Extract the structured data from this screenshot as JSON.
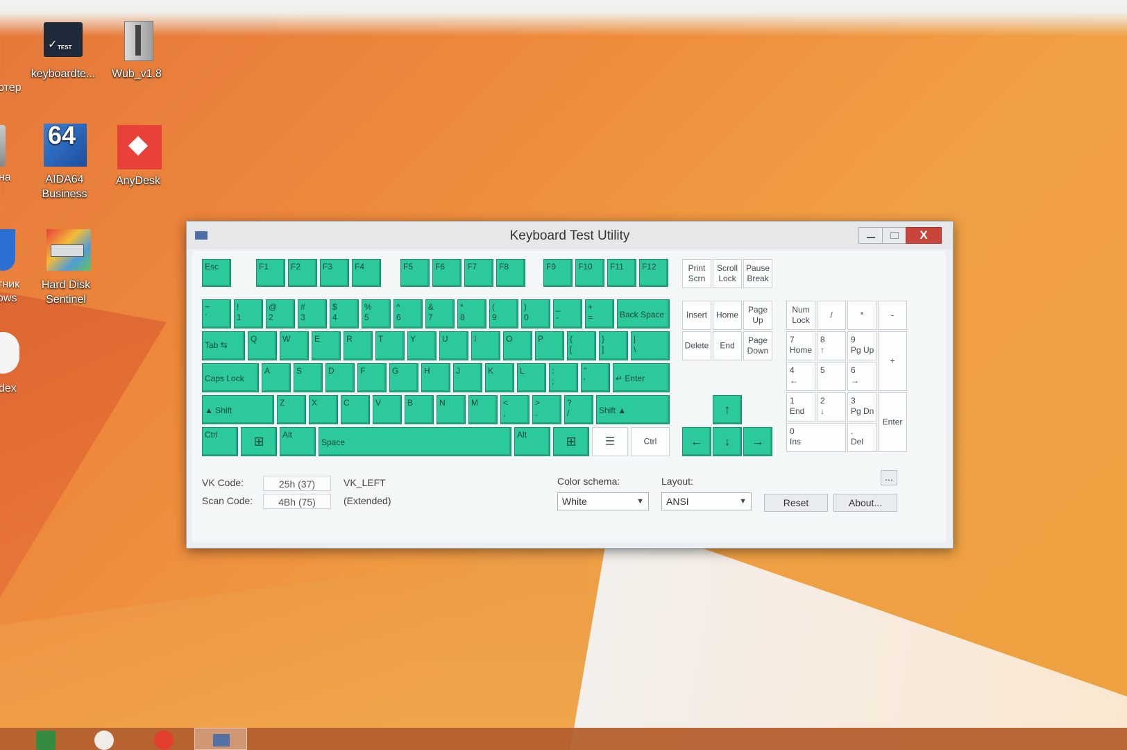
{
  "desktop": {
    "icons": [
      {
        "label": "keyboardte...",
        "name": "keyboardtest-shortcut"
      },
      {
        "label": "Wub_v1.8",
        "name": "wub-shortcut"
      },
      {
        "label": "AIDA64\nBusiness",
        "name": "aida64-shortcut"
      },
      {
        "label": "AnyDesk",
        "name": "anydesk-shortcut"
      },
      {
        "label": "Hard Disk\nSentinel",
        "name": "hard-disk-sentinel-shortcut"
      }
    ],
    "partial_labels": [
      "ютер",
      "на",
      "тник\nows",
      "dex"
    ]
  },
  "window": {
    "title": "Keyboard Test Utility",
    "close_glyph": "X"
  },
  "keyboard": {
    "fn_row": [
      "Esc",
      "F1",
      "F2",
      "F3",
      "F4",
      "F5",
      "F6",
      "F7",
      "F8",
      "F9",
      "F10",
      "F11",
      "F12"
    ],
    "row1": [
      "~\n`",
      "!\n1",
      "@\n2",
      "#\n3",
      "$\n4",
      "%\n5",
      "^\n6",
      "&\n7",
      "*\n8",
      "(\n9",
      ")\n0",
      "_\n-",
      "+\n=",
      "Back Space"
    ],
    "row2": [
      "Tab  ⇆",
      "Q",
      "W",
      "E",
      "R",
      "T",
      "Y",
      "U",
      "I",
      "O",
      "P",
      "{\n[",
      "}\n]",
      "|\n\\"
    ],
    "row3": [
      "Caps Lock",
      "A",
      "S",
      "D",
      "F",
      "G",
      "H",
      "J",
      "K",
      "L",
      ":\n;",
      "\"\n'",
      "↵  Enter"
    ],
    "row4": [
      "▲        Shift",
      "Z",
      "X",
      "C",
      "V",
      "B",
      "N",
      "M",
      "<\n,",
      ">\n.",
      "?\n/",
      "Shift          ▲"
    ],
    "row5": [
      "Ctrl",
      "⊞",
      "Alt",
      "Space",
      "Alt",
      "⊞",
      "☰",
      "Ctrl"
    ],
    "sys": [
      "Print\nScrn",
      "Scroll\nLock",
      "Pause\nBreak"
    ],
    "nav": [
      "Insert",
      "Home",
      "Page\nUp",
      "Delete",
      "End",
      "Page\nDown"
    ],
    "arrows": [
      "↑",
      "←",
      "↓",
      "→"
    ],
    "numpad": [
      "Num\nLock",
      "/",
      "*",
      "-",
      "7\nHome",
      "8\n↑",
      "9\nPg Up",
      "+",
      "4\n←",
      "5",
      "6\n→",
      "1\nEnd",
      "2\n↓",
      "3\nPg Dn",
      "Enter",
      "0\nIns",
      ".\nDel"
    ]
  },
  "status": {
    "vk_label": "VK Code:",
    "vk_value": "25h (37)",
    "vk_name": "VK_LEFT",
    "scan_label": "Scan Code:",
    "scan_value": "4Bh (75)",
    "scan_note": "(Extended)",
    "color_label": "Color schema:",
    "color_value": "White",
    "layout_label": "Layout:",
    "layout_value": "ANSI",
    "more_button": "...",
    "reset_button": "Reset",
    "about_button": "About..."
  },
  "colors": {
    "key_pressed": "#2bc99b",
    "key_unpressed": "#fcfdfd",
    "close_button": "#c9453c"
  }
}
